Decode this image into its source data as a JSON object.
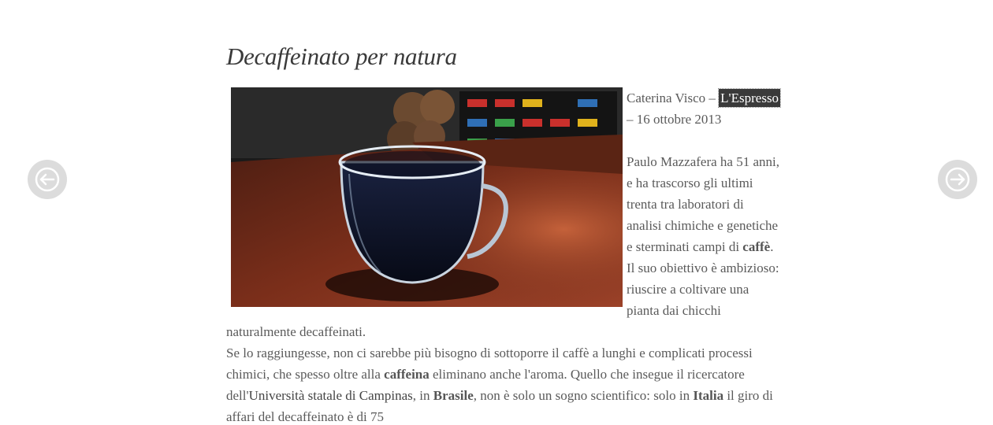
{
  "nav": {
    "prev_icon": "arrow-left-icon",
    "next_icon": "arrow-right-icon"
  },
  "article": {
    "title": "Decaffeinato per natura",
    "byline": {
      "author": "Caterina Visco",
      "dash1": " – ",
      "source": "L'Espresso",
      "dash2": " – ",
      "date": "16 ottobre 2013"
    },
    "p1": {
      "t1": "Paulo Mazzafera ha 51 anni, e ha trascorso gli ultimi trenta tra laboratori di analisi chimiche e genetiche e sterminati campi di ",
      "b1": "caffè",
      "t2": ". Il suo obiettivo è ambizioso: riuscire a coltivare una pianta dai chicchi naturalmente decaffeinati."
    },
    "p2": {
      "t1": "Se lo raggiungesse, non ci sarebbe più bisogno di sottoporre il caffè a lunghi e complicati processi chimici, che spesso oltre alla ",
      "b1": "caffeina",
      "t2": " eliminano anche l'aroma. Quello che insegue il ricercatore dell'",
      "link1": "Università statale di Campinas",
      "t3": ", in ",
      "b2": "Brasile",
      "t4": ", non è solo un sogno scientifico: solo in ",
      "b3": "Italia",
      "t5": " il giro di affari del decaffeinato è di 75"
    }
  },
  "colors": {
    "nav_bg": "#dcdcdc",
    "title": "#3a3a3a",
    "body_text": "#5a5a5a",
    "highlight_bg": "#3a3a3a"
  }
}
